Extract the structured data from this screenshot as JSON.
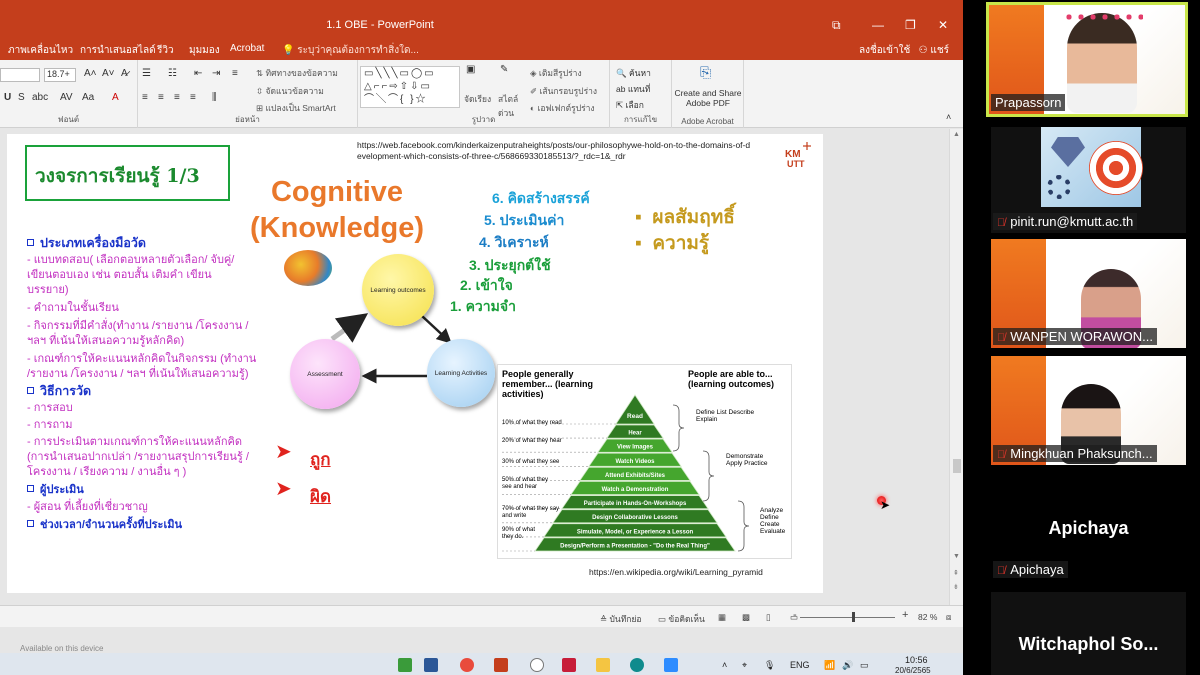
{
  "app": {
    "window_title": "1.1 OBE - PowerPoint",
    "menu": [
      "ภาพเคลื่อนไหว",
      "การนำเสนอสไลด์",
      "รีวิว",
      "มุมมอง",
      "Acrobat"
    ],
    "search_placeholder": "ระบุว่าคุณต้องการทำสิ่งใด...",
    "signin": "ลงชื่อเข้าใช้",
    "share": "แชร์"
  },
  "ribbon": {
    "font_size": "18.7+",
    "font_group": "ฟอนต์",
    "paragraph_group": "ย่อหน้า",
    "drawing_group": "รูปวาด",
    "editing_group": "การแก้ไข",
    "acrobat_group": "Adobe Acrobat",
    "text_direction": "ทิศทางของข้อความ",
    "align_text": "จัดแนวข้อความ",
    "smartart": "แปลงเป็น SmartArt",
    "arrange": "จัดเรียง",
    "quick_styles": "สไตล์ด่วน",
    "shape_fill": "เติมสีรูปร่าง",
    "shape_outline": "เส้นกรอบรูปร่าง",
    "shape_effects": "เอฟเฟกต์รูปร่าง",
    "find": "ค้นหา",
    "replace": "แทนที่",
    "select": "เลือก",
    "create_pdf": "Create and Share Adobe PDF"
  },
  "slide": {
    "title": "วงจรการเรียนรู้ 1/3",
    "source_url": "https://web.facebook.com/kinderkaizenputraheights/posts/our-philosophywe-hold-on-to-the-domains-of-development-which-consists-of-three-c/568669330185513/?_rdc=1&_rdr",
    "logo": "KMUTT",
    "cognitive_line1": "Cognitive",
    "cognitive_line2": "(Knowledge)",
    "levels": [
      "6. คิดสร้างสรรค์",
      "5. ประเมินค่า",
      "4. วิเคราะห์",
      "3. ประยุกต์ใช้",
      "2. เข้าใจ",
      "1. ความจำ"
    ],
    "outcomes": [
      "ผลสัมฤทธิ์",
      "ความรู้"
    ],
    "sections": [
      {
        "header": "ประเภทเครื่องมือวัด",
        "items": [
          "- แบบทดสอบ( เลือกตอบหลายตัวเลือก/ จับคู่/",
          "เขียนตอบเอง เช่น ตอบสั้น  เติมคำ  เขียน",
          "บรรยาย)",
          "- คำถามในชั้นเรียน",
          "- กิจกรรมที่มีคำสั่ง(ทำงาน /รายงาน /โครงงาน /",
          "ฯลฯ ที่เน้นให้เสนอความรู้หลักคิด)",
          "- เกณฑ์การให้คะแนนหลักคิดในกิจกรรม (ทำงาน",
          "/รายงาน /โครงงาน / ฯลฯ ที่เน้นให้เสนอความรู้)"
        ]
      },
      {
        "header": "วิธีการวัด",
        "items": [
          "- การสอบ",
          "- การถาม",
          "- การประเมินตามเกณฑ์การให้คะแนนหลักคิด",
          "(การนำเสนอปากเปล่า /รายงานสรุปการเรียนรู้ /",
          "โครงงาน / เรียงความ / งานอื่น ๆ )"
        ]
      },
      {
        "header": "ผู้ประเมิน",
        "items": [
          "- ผู้สอน ที่เลี้ยงที่เชี่ยวชาญ"
        ]
      },
      {
        "header": "ช่วงเวลา/จำนวนครั้งที่ประเมิน",
        "items": []
      }
    ],
    "answers": [
      "ถูก",
      "ผิด"
    ],
    "cycle": {
      "top": "Learning outcomes",
      "left": "Assessment",
      "right": "Learning Activities"
    },
    "pyramid": {
      "left_header": "People generally remember... (learning activities)",
      "right_header": "People are able to... (learning outcomes)",
      "levels": [
        "Read",
        "Hear",
        "View Images",
        "Watch Videos",
        "Attend Exhibits/Sites",
        "Watch a Demonstration",
        "Participate in Hands-On-Workshops",
        "Design Collaborative Lessons",
        "Simulate, Model, or Experience a Lesson",
        "Design/Perform a Presentation - \"Do the Real Thing\""
      ],
      "percent_labels": [
        "10% of what they read",
        "20% of what they hear",
        "30% of what they see",
        "50% of what they see and hear",
        "70% of what they say and write",
        "90% of what they do."
      ],
      "outcome_labels": [
        "Define List Describe Explain",
        "Demonstrate Apply Practice",
        "Analyze Define Create Evaluate"
      ]
    },
    "wiki_url": "https://en.wikipedia.org/wiki/Learning_pyramid"
  },
  "statusbar": {
    "notes": "บันทึกย่อ",
    "comments": "ข้อคิดเห็น",
    "zoom": "82 %",
    "notes_placeholder": "Available on this device"
  },
  "taskbar": {
    "lang": "ENG",
    "time": "10:56",
    "date": "20/6/2565"
  },
  "participants": [
    {
      "name": "Prapassorn",
      "video": true,
      "muted": false,
      "active": true
    },
    {
      "name": "pinit.run@kmutt.ac.th",
      "video": true,
      "muted": true
    },
    {
      "name": "WANPEN WORAWON...",
      "video": true,
      "muted": true
    },
    {
      "name": "Mingkhuan Phaksunch...",
      "video": true,
      "muted": true
    },
    {
      "name": "Apichaya",
      "display": "Apichaya",
      "video": false,
      "muted": true
    },
    {
      "name": "Witchaphol So...",
      "display": "Witchaphol  So...",
      "video": false,
      "muted": false
    }
  ],
  "colors": {
    "ppt_accent": "#c43e1c",
    "title_green": "#1b8a2e",
    "cognitive_orange": "#e9782b",
    "level_colors": [
      "#1aa2d8",
      "#1a8ccf",
      "#1a7cc4",
      "#1a9e3a",
      "#1a9e3a",
      "#1a9e3a"
    ],
    "outcome_gold": "#c59a1e",
    "active_speaker": "#c8e64a"
  }
}
